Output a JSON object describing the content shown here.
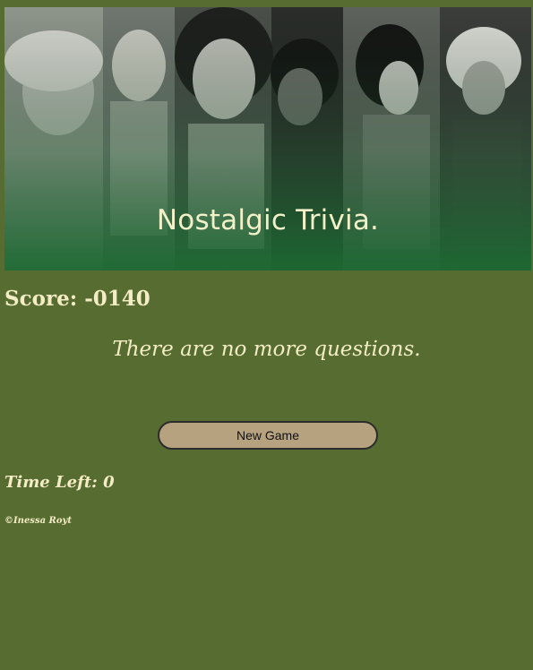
{
  "banner": {
    "title": "Nostalgic Trivia."
  },
  "score": {
    "text": "Score: -0140"
  },
  "message": {
    "text": "There are no more questions."
  },
  "controls": {
    "new_game_label": "New Game"
  },
  "timer": {
    "text": "Time Left: 0"
  },
  "footer": {
    "copyright": "©Inessa Royt"
  },
  "colors": {
    "page_background": "#566c31",
    "text": "#f4ecc4",
    "button_background": "#b7a27f",
    "banner_green": "#1e6b33"
  }
}
